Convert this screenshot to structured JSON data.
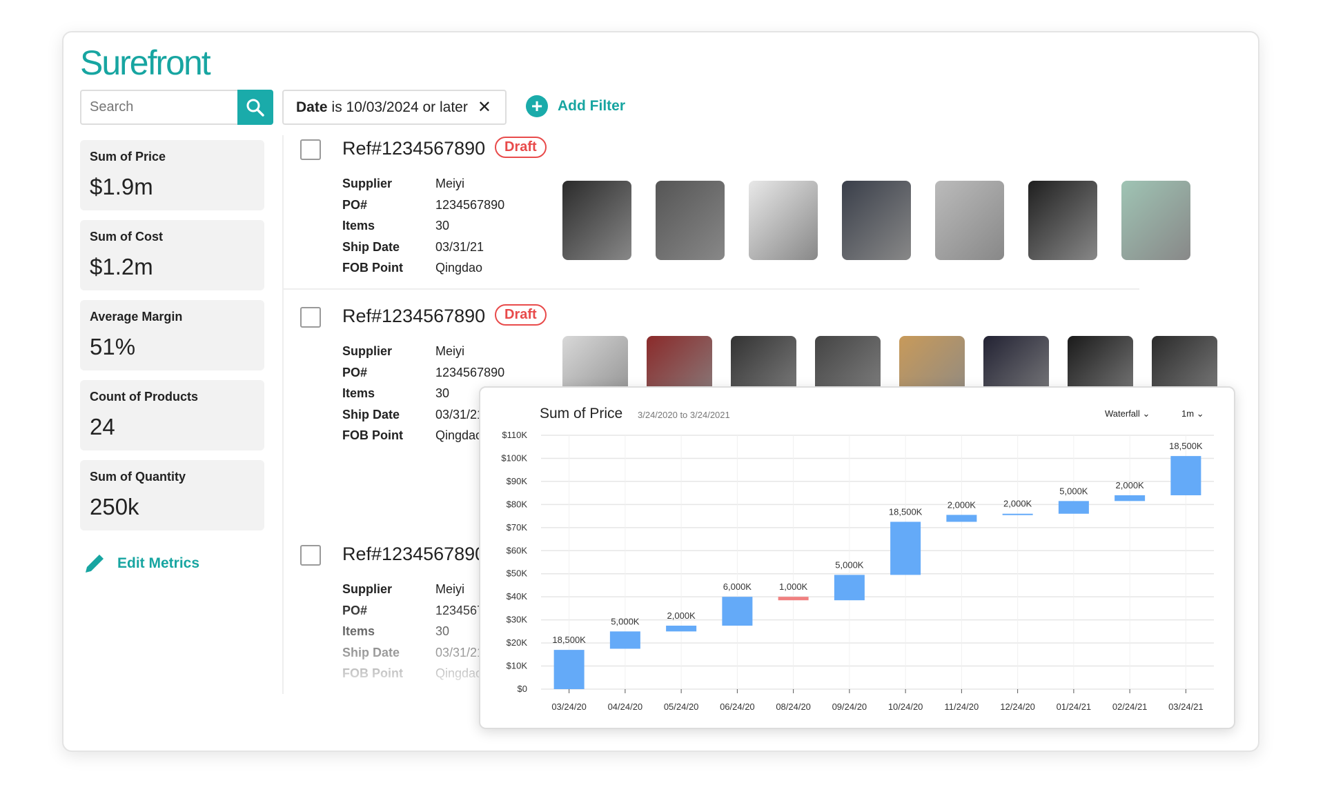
{
  "brand": {
    "name": "Surefront",
    "accent": "#17a5a1"
  },
  "search": {
    "placeholder": "Search",
    "icon": "search-icon"
  },
  "filter": {
    "field": "Date",
    "text": "is 10/03/2024 or later",
    "remove": "✕"
  },
  "add_filter": {
    "icon": "+",
    "label": "Add Filter"
  },
  "metrics": [
    {
      "label": "Sum of Price",
      "value": "$1.9m"
    },
    {
      "label": "Sum of Cost",
      "value": "$1.2m"
    },
    {
      "label": "Average Margin",
      "value": "51%"
    },
    {
      "label": "Count of Products",
      "value": "24"
    },
    {
      "label": "Sum of Quantity",
      "value": "250k"
    }
  ],
  "edit_metrics": "Edit Metrics",
  "orders": [
    {
      "ref": "Ref#1234567890",
      "status": "Draft",
      "fields": [
        [
          "Supplier",
          "Meiyi"
        ],
        [
          "PO#",
          "1234567890"
        ],
        [
          "Items",
          "30"
        ],
        [
          "Ship Date",
          "03/31/21"
        ],
        [
          "FOB Point",
          "Qingdao"
        ]
      ],
      "products": [
        "smartwatch",
        "coffee-maker",
        "thermostat",
        "laptop",
        "alarm-clock",
        "headphones",
        "earbuds-case"
      ]
    },
    {
      "ref": "Ref#1234567890",
      "status": "Draft",
      "fields": [
        [
          "Supplier",
          "Meiyi"
        ],
        [
          "PO#",
          "1234567890"
        ],
        [
          "Items",
          "30"
        ],
        [
          "Ship Date",
          "03/31/21"
        ],
        [
          "FOB Point",
          "Qingdao"
        ]
      ],
      "products": [
        "washing-machine",
        "guitar",
        "amplifier",
        "game-controller",
        "speakers",
        "smartphone",
        "tv",
        "robot-vacuum"
      ]
    },
    {
      "ref": "Ref#1234567890",
      "status": "",
      "fields": [
        [
          "Supplier",
          "Meiyi"
        ],
        [
          "PO#",
          "1234567890"
        ],
        [
          "Items",
          "30"
        ],
        [
          "Ship Date",
          "03/31/21"
        ],
        [
          "FOB Point",
          "Qingdao"
        ]
      ],
      "products": []
    }
  ],
  "chart_data": {
    "type": "waterfall",
    "title": "Sum of Price",
    "subtitle": "3/24/2020 to 3/24/2021",
    "chart_type_select": "Waterfall",
    "interval_select": "1m",
    "ylim": [
      0,
      110
    ],
    "yticks": [
      "$0",
      "$10K",
      "$20K",
      "$30K",
      "$40K",
      "$50K",
      "$60K",
      "$70K",
      "$80K",
      "$90K",
      "$100K",
      "$110K"
    ],
    "grid": true,
    "categories": [
      "03/24/20",
      "04/24/20",
      "05/24/20",
      "06/24/20",
      "08/24/20",
      "09/24/20",
      "10/24/20",
      "11/24/20",
      "12/24/20",
      "01/24/21",
      "02/24/21",
      "03/24/21"
    ],
    "bars": [
      {
        "start": 0,
        "end": 17,
        "label": "18,500K"
      },
      {
        "start": 17.5,
        "end": 25,
        "label": "5,000K"
      },
      {
        "start": 25,
        "end": 27.5,
        "label": "2,000K"
      },
      {
        "start": 27.5,
        "end": 40,
        "label": "6,000K"
      },
      {
        "start": 40,
        "end": 38.5,
        "label": "1,000K"
      },
      {
        "start": 38.5,
        "end": 49.5,
        "label": "5,000K"
      },
      {
        "start": 49.5,
        "end": 72.5,
        "label": "18,500K"
      },
      {
        "start": 72.5,
        "end": 75.5,
        "label": "2,000K"
      },
      {
        "start": 75.5,
        "end": 76,
        "label": "2,000K"
      },
      {
        "start": 76,
        "end": 81.5,
        "label": "5,000K"
      },
      {
        "start": 81.5,
        "end": 84,
        "label": "2,000K"
      },
      {
        "start": 84,
        "end": 101,
        "label": "18,500K"
      }
    ],
    "colors": {
      "increase": "#64aaf8",
      "decrease": "#f08080"
    }
  }
}
